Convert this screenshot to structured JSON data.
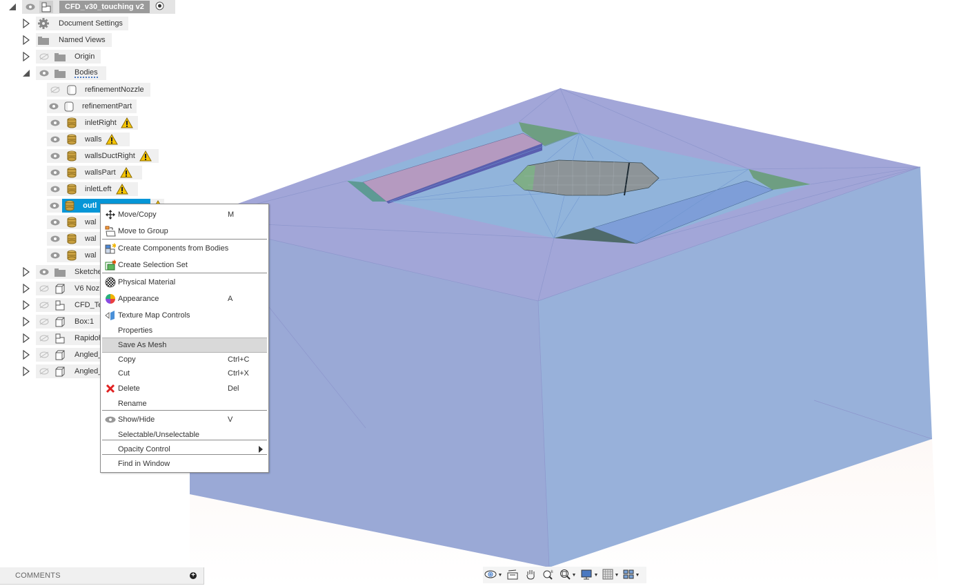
{
  "browser": {
    "root": {
      "label": "CFD_v30_touching v2",
      "expanded": true,
      "visible": true,
      "icon": "component-icon",
      "active_radio": true
    },
    "top_items": [
      {
        "label": "Document Settings",
        "icon": "gear-icon",
        "expanded": false,
        "eye": "none"
      },
      {
        "label": "Named Views",
        "icon": "folder-icon",
        "expanded": false,
        "eye": "none"
      },
      {
        "label": "Origin",
        "icon": "folder-icon",
        "expanded": false,
        "eye": "hidden"
      },
      {
        "label": "Bodies",
        "icon": "folder-icon",
        "expanded": true,
        "eye": "visible"
      }
    ],
    "bodies": [
      {
        "label": "refinementNozzle",
        "icon": "body-white-icon",
        "eye": "hidden",
        "warning": false
      },
      {
        "label": "refinementPart",
        "icon": "body-white-icon",
        "eye": "visible",
        "warning": false
      },
      {
        "label": "inletRight",
        "icon": "body-gold-icon",
        "eye": "visible",
        "warning": true
      },
      {
        "label": "walls",
        "icon": "body-gold-icon",
        "eye": "visible",
        "warning": true
      },
      {
        "label": "wallsDuctRight",
        "icon": "body-gold-icon",
        "eye": "visible",
        "warning": true
      },
      {
        "label": "wallsPart",
        "icon": "body-gold-icon",
        "eye": "visible",
        "warning": true
      },
      {
        "label": "inletLeft",
        "icon": "body-gold-icon",
        "eye": "visible",
        "warning": true
      },
      {
        "label": "outl",
        "icon": "body-gold-icon",
        "eye": "visible",
        "warning": true,
        "selected": true
      },
      {
        "label": "wal",
        "icon": "body-gold-icon",
        "eye": "visible",
        "warning": false
      },
      {
        "label": "wal",
        "icon": "body-gold-icon",
        "eye": "visible",
        "warning": false
      },
      {
        "label": "wal",
        "icon": "body-gold-icon",
        "eye": "visible",
        "warning": false
      }
    ],
    "bottom_items": [
      {
        "label": "Sketche",
        "icon": "folder-icon",
        "eye": "visible"
      },
      {
        "label": "V6 Noz",
        "icon": "body-component-icon",
        "eye": "hidden"
      },
      {
        "label": "CFD_Te",
        "icon": "component-icon",
        "eye": "hidden"
      },
      {
        "label": "Box:1",
        "icon": "body-component-icon",
        "eye": "hidden"
      },
      {
        "label": "Rapidoh",
        "icon": "component-icon",
        "eye": "hidden"
      },
      {
        "label": "Angled_",
        "icon": "body-component-icon",
        "eye": "hidden"
      },
      {
        "label": "Angled_",
        "icon": "body-component-icon",
        "eye": "hidden"
      }
    ]
  },
  "context_menu": {
    "items": [
      {
        "label": "Move/Copy",
        "shortcut": "M",
        "icon": "move-icon"
      },
      {
        "label": "Move to Group",
        "shortcut": "",
        "icon": "move-to-group-icon"
      },
      {
        "label": "Create Components from Bodies",
        "shortcut": "",
        "icon": "create-components-icon"
      },
      {
        "label": "Create Selection Set",
        "shortcut": "",
        "icon": "selection-set-icon"
      },
      {
        "label": "Physical Material",
        "shortcut": "",
        "icon": "physical-material-icon"
      },
      {
        "label": "Appearance",
        "shortcut": "A",
        "icon": "appearance-icon"
      },
      {
        "label": "Texture Map Controls",
        "shortcut": "",
        "icon": "texture-map-icon"
      },
      {
        "label": "Properties",
        "shortcut": "",
        "icon": ""
      },
      {
        "label": "Save As Mesh",
        "shortcut": "",
        "icon": "",
        "highlighted": true
      },
      {
        "label": "Copy",
        "shortcut": "Ctrl+C",
        "icon": ""
      },
      {
        "label": "Cut",
        "shortcut": "Ctrl+X",
        "icon": ""
      },
      {
        "label": "Delete",
        "shortcut": "Del",
        "icon": "delete-icon"
      },
      {
        "label": "Rename",
        "shortcut": "",
        "icon": ""
      },
      {
        "label": "Show/Hide",
        "shortcut": "V",
        "icon": "eye-icon"
      },
      {
        "label": "Selectable/Unselectable",
        "shortcut": "",
        "icon": ""
      },
      {
        "label": "Opacity Control",
        "shortcut": "",
        "icon": "",
        "submenu": true
      },
      {
        "label": "Find in Window",
        "shortcut": "",
        "icon": ""
      }
    ]
  },
  "comments": {
    "label": "COMMENTS"
  },
  "nav_toolbar": {
    "tools": [
      {
        "name": "orbit",
        "icon": "orbit-icon",
        "dropdown": true
      },
      {
        "name": "look-at",
        "icon": "look-at-icon",
        "dropdown": false
      },
      {
        "name": "pan",
        "icon": "pan-hand-icon",
        "dropdown": false
      },
      {
        "name": "zoom",
        "icon": "zoom-icon",
        "dropdown": false
      },
      {
        "name": "fit",
        "icon": "fit-window-icon",
        "dropdown": true
      },
      {
        "name": "display-settings",
        "icon": "display-settings-icon",
        "dropdown": true
      },
      {
        "name": "grid-snaps",
        "icon": "grid-icon",
        "dropdown": true
      },
      {
        "name": "viewports",
        "icon": "viewports-icon",
        "dropdown": true
      }
    ]
  },
  "colors": {
    "selection": "#0696d7",
    "model_top": "#a0a5d8",
    "model_front": "#9aa9d6",
    "model_right": "#99b2da",
    "warning": "#f5c400"
  }
}
